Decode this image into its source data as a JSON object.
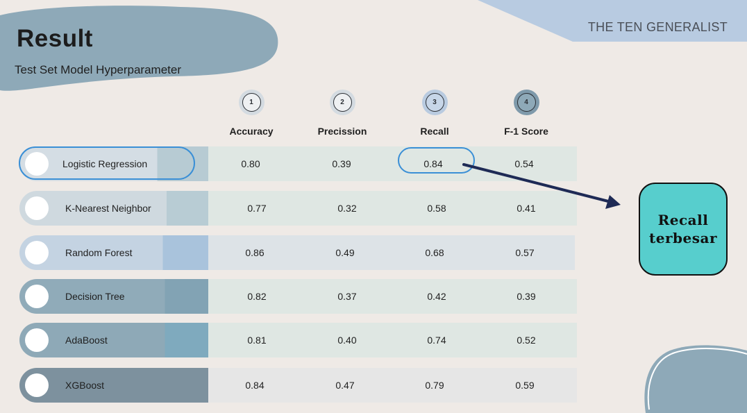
{
  "slide": {
    "title": "Result",
    "subtitle": "Test Set Model Hyperparameter",
    "brand": "THE TEN GENERALIST"
  },
  "columns": [
    {
      "number": "1",
      "label": "Accuracy"
    },
    {
      "number": "2",
      "label": "Precission"
    },
    {
      "number": "3",
      "label": "Recall"
    },
    {
      "number": "4",
      "label": "F-1 Score"
    }
  ],
  "rows": [
    {
      "model": "Logistic Regression",
      "accuracy": "0.80",
      "precision": "0.39",
      "recall": "0.84",
      "f1": "0.54"
    },
    {
      "model": "K-Nearest Neighbor",
      "accuracy": "0.77",
      "precision": "0.32",
      "recall": "0.58",
      "f1": "0.41"
    },
    {
      "model": "Random Forest",
      "accuracy": "0.86",
      "precision": "0.49",
      "recall": "0.68",
      "f1": "0.57"
    },
    {
      "model": "Decision Tree",
      "accuracy": "0.82",
      "precision": "0.37",
      "recall": "0.42",
      "f1": "0.39"
    },
    {
      "model": "AdaBoost",
      "accuracy": "0.81",
      "precision": "0.40",
      "recall": "0.74",
      "f1": "0.52"
    },
    {
      "model": "XGBoost",
      "accuracy": "0.84",
      "precision": "0.47",
      "recall": "0.79",
      "f1": "0.59"
    }
  ],
  "callout": {
    "line1": "Recall",
    "line2": "terbesar"
  },
  "colors": {
    "background": "#efeae6",
    "accent_blue": "#3a8fd6",
    "callout_teal": "#57cecd",
    "arrow_navy": "#1e2a55"
  }
}
